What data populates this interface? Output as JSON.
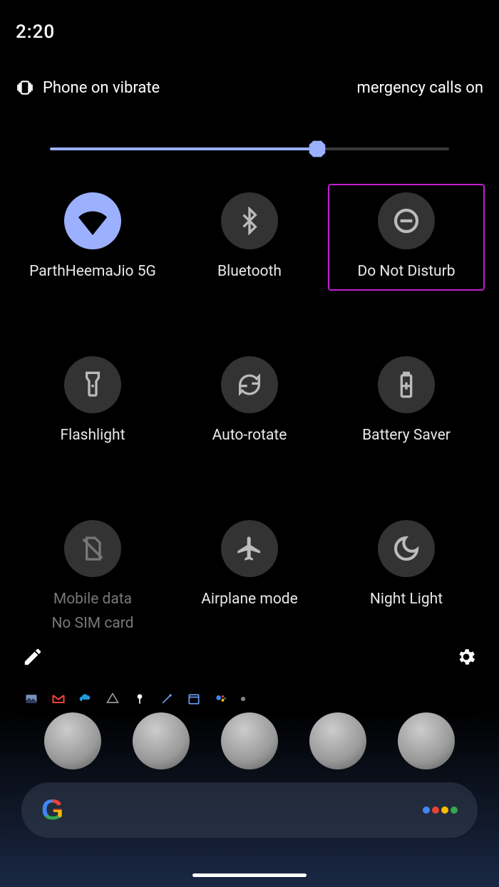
{
  "status": {
    "clock": "2:20",
    "vibrate_label": "Phone on vibrate",
    "emergency_label": "mergency calls on"
  },
  "brightness": {
    "percent": 67
  },
  "tiles": [
    {
      "name": "wifi",
      "label": "ParthHeemaJio 5G",
      "sublabel": "",
      "active": true,
      "highlighted": false,
      "disabled": false,
      "icon": "wifi"
    },
    {
      "name": "bluetooth",
      "label": "Bluetooth",
      "sublabel": "",
      "active": false,
      "highlighted": false,
      "disabled": false,
      "icon": "bluetooth"
    },
    {
      "name": "dnd",
      "label": "Do Not Disturb",
      "sublabel": "",
      "active": false,
      "highlighted": true,
      "disabled": false,
      "icon": "dnd"
    },
    {
      "name": "flashlight",
      "label": "Flashlight",
      "sublabel": "",
      "active": false,
      "highlighted": false,
      "disabled": false,
      "icon": "flashlight"
    },
    {
      "name": "autorotate",
      "label": "Auto-rotate",
      "sublabel": "",
      "active": false,
      "highlighted": false,
      "disabled": false,
      "icon": "autorotate"
    },
    {
      "name": "battery",
      "label": "Battery Saver",
      "sublabel": "",
      "active": false,
      "highlighted": false,
      "disabled": false,
      "icon": "battery"
    },
    {
      "name": "mobiledata",
      "label": "Mobile data",
      "sublabel": "No SIM card",
      "active": false,
      "highlighted": false,
      "disabled": true,
      "icon": "nosim"
    },
    {
      "name": "airplane",
      "label": "Airplane mode",
      "sublabel": "",
      "active": false,
      "highlighted": false,
      "disabled": false,
      "icon": "airplane"
    },
    {
      "name": "nightlight",
      "label": "Night Light",
      "sublabel": "",
      "active": false,
      "highlighted": false,
      "disabled": false,
      "icon": "moon"
    }
  ],
  "footer": {
    "edit": "edit",
    "settings": "settings"
  },
  "notification_icons": [
    "photos",
    "gmail",
    "onedrive",
    "drive",
    "key",
    "wand",
    "calendar",
    "assistant",
    "more"
  ],
  "assistant_colors": [
    "#4285F4",
    "#EA4335",
    "#FBBC05",
    "#34A853"
  ],
  "google_letter": "G"
}
